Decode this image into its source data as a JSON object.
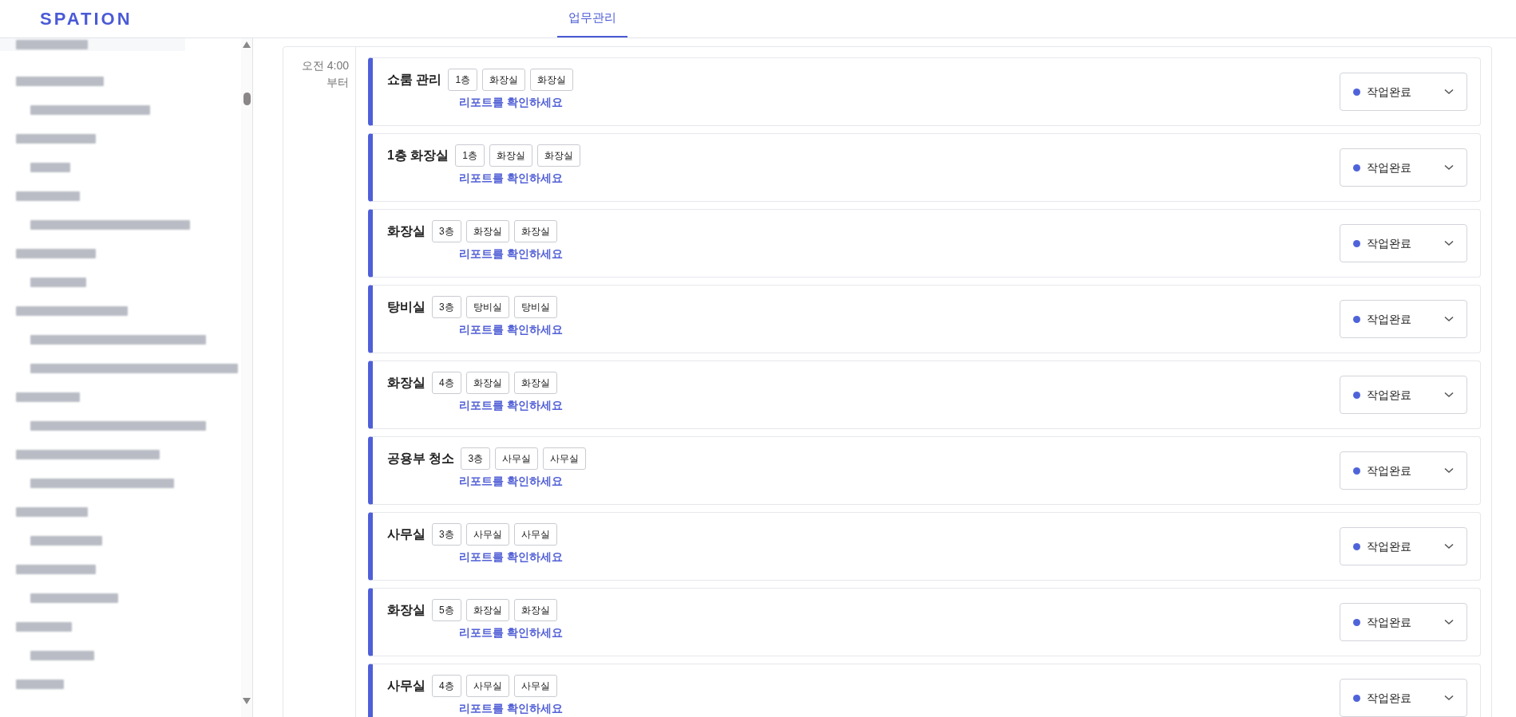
{
  "header": {
    "logo": "SPATION",
    "tabs": [
      {
        "label": "업무관리",
        "selected": true
      }
    ]
  },
  "schedule": {
    "time_label": "오전 4:00\n부터",
    "tasks": [
      {
        "title": "쇼룸 관리",
        "tags": [
          "1층",
          "화장실",
          "화장실"
        ],
        "link": "리포트를 확인하세요",
        "status": "작업완료"
      },
      {
        "title": "1층 화장실",
        "tags": [
          "1층",
          "화장실",
          "화장실"
        ],
        "link": "리포트를 확인하세요",
        "status": "작업완료"
      },
      {
        "title": "화장실",
        "tags": [
          "3층",
          "화장실",
          "화장실"
        ],
        "link": "리포트를 확인하세요",
        "status": "작업완료"
      },
      {
        "title": "탕비실",
        "tags": [
          "3층",
          "탕비실",
          "탕비실"
        ],
        "link": "리포트를 확인하세요",
        "status": "작업완료"
      },
      {
        "title": "화장실",
        "tags": [
          "4층",
          "화장실",
          "화장실"
        ],
        "link": "리포트를 확인하세요",
        "status": "작업완료"
      },
      {
        "title": "공용부 청소",
        "tags": [
          "3층",
          "사무실",
          "사무실"
        ],
        "link": "리포트를 확인하세요",
        "status": "작업완료"
      },
      {
        "title": "사무실",
        "tags": [
          "3층",
          "사무실",
          "사무실"
        ],
        "link": "리포트를 확인하세요",
        "status": "작업완료"
      },
      {
        "title": "화장실",
        "tags": [
          "5층",
          "화장실",
          "화장실"
        ],
        "link": "리포트를 확인하세요",
        "status": "작업완료"
      },
      {
        "title": "사무실",
        "tags": [
          "4층",
          "사무실",
          "사무실"
        ],
        "link": "리포트를 확인하세요",
        "status": "작업완료"
      }
    ]
  }
}
